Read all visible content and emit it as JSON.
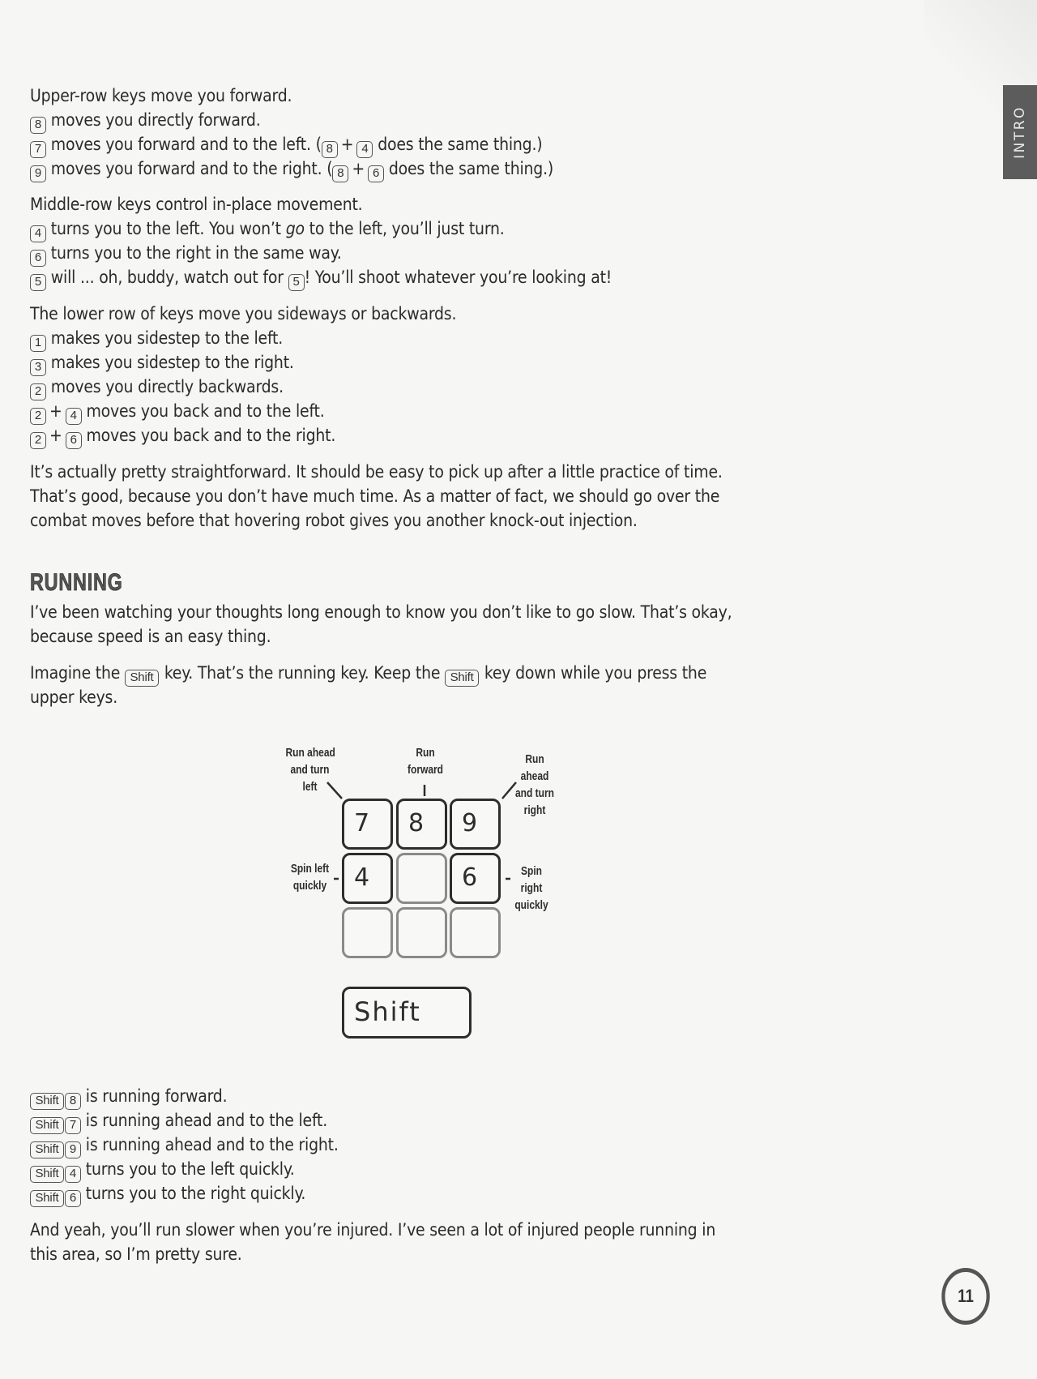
{
  "intro_tab": "INTRO",
  "page_number": "11",
  "upper_row": {
    "intro": "Upper-row keys move you forward.",
    "lines": [
      {
        "keys": [
          "8"
        ],
        "text": " moves you directly forward."
      },
      {
        "keys": [
          "7"
        ],
        "text": " moves you forward and to the left. (",
        "combo": [
          "8",
          "4"
        ],
        "tail": " does the same thing.)"
      },
      {
        "keys": [
          "9"
        ],
        "text": " moves you forward and to the right. (",
        "combo": [
          "8",
          "6"
        ],
        "tail": " does the same thing.)"
      }
    ]
  },
  "middle_row": {
    "intro": "Middle-row keys control in-place movement.",
    "line1": {
      "key": "4",
      "pre": " turns you to the left. You won’t ",
      "em": "go",
      "post": " to the left, you’ll just turn."
    },
    "line2": {
      "key": "6",
      "text": " turns you to the right in the same way."
    },
    "line3": {
      "key": "5",
      "text1": " will ... oh, buddy, watch out for ",
      "key2": "5",
      "text2": "! You’ll shoot whatever you’re looking at!"
    }
  },
  "lower_row": {
    "intro": "The lower row of keys move you sideways or backwards.",
    "line1": {
      "key": "1",
      "text": " makes you sidestep to the left."
    },
    "line2": {
      "key": "3",
      "text": " makes you sidestep to the right."
    },
    "line3": {
      "key": "2",
      "text": " moves you directly backwards."
    },
    "line4": {
      "key": "2",
      "plus": "+",
      "key2": "4",
      "text": " moves you back and to the left."
    },
    "line5": {
      "key": "2",
      "plus": "+",
      "key2": "6",
      "text": " moves you back and to the right."
    }
  },
  "summary": [
    "It’s actually pretty straightforward. It should be easy to pick up after a little practice of time.",
    "That’s good, because you don’t have much time. As a matter of fact, we should go over the",
    "combat moves before that hovering robot gives you another knock-out injection."
  ],
  "running": {
    "heading": "RUNNING",
    "para1": [
      "I’ve been watching your thoughts long enough to know you don’t like to go slow. That’s okay,",
      "because speed is an easy thing."
    ],
    "para2": {
      "pre": "Imagine the ",
      "key": "Shift",
      "mid": " key. That’s the running key. Keep the ",
      "key2": "Shift",
      "post": " key down while you press the",
      "line2": "upper keys."
    }
  },
  "diagram": {
    "labels": {
      "run_ahead_left": [
        "Run ahead",
        "and turn",
        "left"
      ],
      "run_forward": [
        "Run",
        "forward"
      ],
      "run_ahead_right": [
        "Run",
        "ahead",
        "and turn",
        "right"
      ],
      "spin_left": [
        "Spin left",
        "quickly"
      ],
      "spin_right": [
        "Spin",
        "right",
        "quickly"
      ]
    },
    "keys": {
      "k7": "7",
      "k8": "8",
      "k9": "9",
      "k4": "4",
      "k6": "6",
      "shift": "Shift"
    }
  },
  "shift_combos": [
    {
      "mod": "Shift",
      "key": "8",
      "text": " is running forward."
    },
    {
      "mod": "Shift",
      "key": "7",
      "text": " is running ahead and to the left."
    },
    {
      "mod": "Shift",
      "key": "9",
      "text": " is running ahead and to the right."
    },
    {
      "mod": "Shift",
      "key": "4",
      "text": " turns you to the left quickly."
    },
    {
      "mod": "Shift",
      "key": "6",
      "text": " turns you to the right quickly."
    }
  ],
  "closing": [
    "And yeah, you’ll run slower when you’re injured. I’ve seen a lot of injured people running in",
    "this area, so I’m pretty sure."
  ]
}
